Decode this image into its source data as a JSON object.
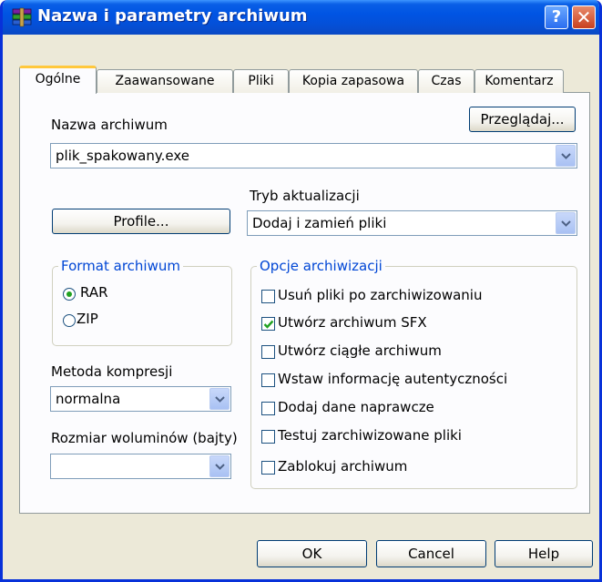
{
  "window": {
    "title": "Nazwa i parametry archiwum",
    "help_glyph": "?",
    "close_glyph": "✕"
  },
  "tabs": [
    {
      "label": "Ogólne",
      "active": true
    },
    {
      "label": "Zaawansowane"
    },
    {
      "label": "Pliki"
    },
    {
      "label": "Kopia zapasowa"
    },
    {
      "label": "Czas"
    },
    {
      "label": "Komentarz"
    }
  ],
  "general": {
    "archive_name_label": "Nazwa archiwum",
    "browse_button": "Przeglądaj...",
    "archive_name_value": "plik_spakowany.exe",
    "update_mode_label": "Tryb aktualizacji",
    "update_mode_value": "Dodaj i zamień pliki",
    "profiles_button": "Profile...",
    "format_group": {
      "title": "Format archiwum",
      "options": [
        {
          "label": "RAR",
          "selected": true
        },
        {
          "label": "ZIP",
          "selected": false
        }
      ]
    },
    "compression_label": "Metoda kompresji",
    "compression_value": "normalna",
    "volume_label": "Rozmiar woluminów (bajty)",
    "volume_value": "",
    "options_group": {
      "title": "Opcje archiwizacji",
      "items": [
        {
          "label": "Usuń pliki po zarchiwizowaniu",
          "checked": false
        },
        {
          "label": "Utwórz archiwum SFX",
          "checked": true
        },
        {
          "label": "Utwórz ciągłe archiwum",
          "checked": false
        },
        {
          "label": "Wstaw informację autentyczności",
          "checked": false
        },
        {
          "label": "Dodaj dane naprawcze",
          "checked": false
        },
        {
          "label": "Testuj zarchiwizowane pliki",
          "checked": false
        },
        {
          "label": "Zablokuj archiwum",
          "checked": false
        }
      ]
    }
  },
  "buttons": {
    "ok": "OK",
    "cancel": "Cancel",
    "help": "Help"
  },
  "colors": {
    "titlebar": "#0054e3",
    "dialog_bg": "#ece9d8",
    "group_title": "#0046d5",
    "check": "#21a121"
  }
}
